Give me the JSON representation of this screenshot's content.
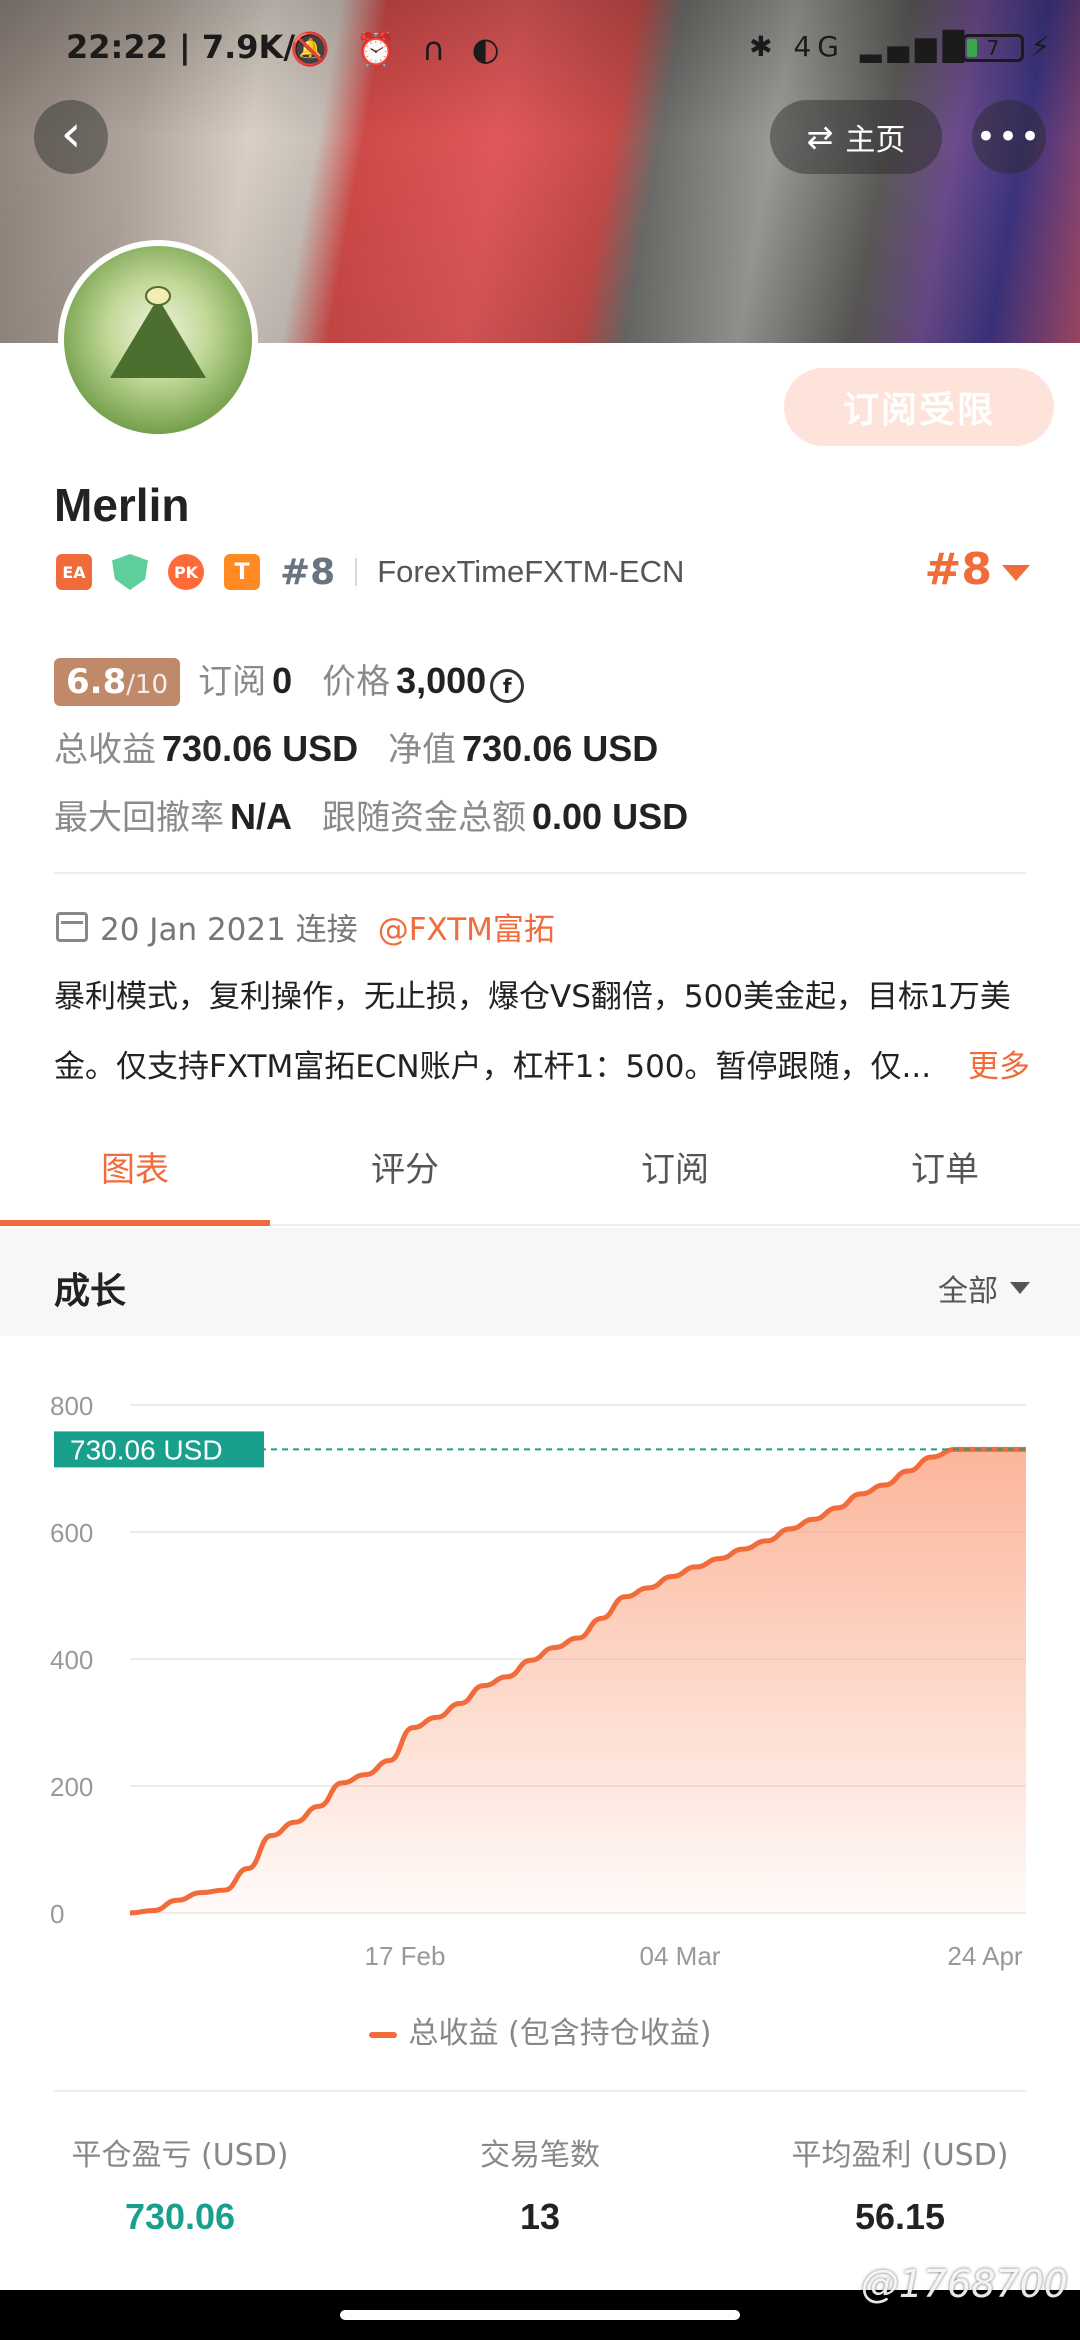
{
  "status_bar": {
    "time": "22:22",
    "net_speed": "7.9K/s",
    "network": "4G",
    "battery": "7"
  },
  "header": {
    "home_label": "主页",
    "subscribe_label": "订阅受限"
  },
  "profile": {
    "name": "Merlin",
    "badges": [
      "EA",
      "PK",
      "T"
    ],
    "rank": "#8",
    "broker": "ForexTimeFXTM-ECN",
    "rank_big": "#8"
  },
  "stats": {
    "score": "6.8",
    "score_max": "/10",
    "subscribe_label": "订阅",
    "subscribe_value": "0",
    "price_label": "价格",
    "price_value": "3,000",
    "total_profit_label": "总收益",
    "total_profit_value": "730.06 USD",
    "net_value_label": "净值",
    "net_value_value": "730.06 USD",
    "max_drawdown_label": "最大回撤率",
    "max_drawdown_value": "N/A",
    "follow_funds_label": "跟随资金总额",
    "follow_funds_value": "0.00 USD"
  },
  "connect": {
    "date": "20 Jan 2021 连接",
    "handle": "@FXTM富拓"
  },
  "description": {
    "line1": "暴利模式，复利操作，无止损，爆仓VS翻倍，500美金起，目标1万美",
    "line2": "金。仅支持FXTM富拓ECN账户，杠杆1：500。暂停跟随，仅...",
    "more": "更多"
  },
  "tabs": [
    "图表",
    "评分",
    "订阅",
    "订单"
  ],
  "section": {
    "title": "成长",
    "filter": "全部"
  },
  "chart_data": {
    "type": "area",
    "y_ticks": [
      "800",
      "600",
      "400",
      "200",
      "0"
    ],
    "ylim": [
      0,
      800
    ],
    "x_tick_labels": [
      "17 Feb",
      "04 Mar",
      "24 Apr"
    ],
    "current_label": "730.06 USD",
    "current_value": 730.06,
    "series": [
      {
        "name": "总收益 (包含持仓收益)",
        "values": [
          0,
          4,
          20,
          32,
          36,
          70,
          122,
          143,
          168,
          205,
          218,
          240,
          292,
          308,
          330,
          358,
          372,
          398,
          418,
          433,
          464,
          498,
          512,
          530,
          545,
          558,
          573,
          586,
          605,
          620,
          638,
          660,
          674,
          696,
          718,
          730.06,
          730.06,
          730.06,
          730.06
        ]
      }
    ],
    "colors": {
      "line": "#f26b3a",
      "fill": "#fba888",
      "marker": "#18a08c"
    },
    "legend": "总收益 (包含持仓收益)"
  },
  "bottom_stats": [
    {
      "label": "平仓盈亏 (USD)",
      "value": "730.06"
    },
    {
      "label": "交易笔数",
      "value": "13"
    },
    {
      "label": "平均盈利 (USD)",
      "value": "56.15"
    }
  ],
  "watermark": "@1768700"
}
